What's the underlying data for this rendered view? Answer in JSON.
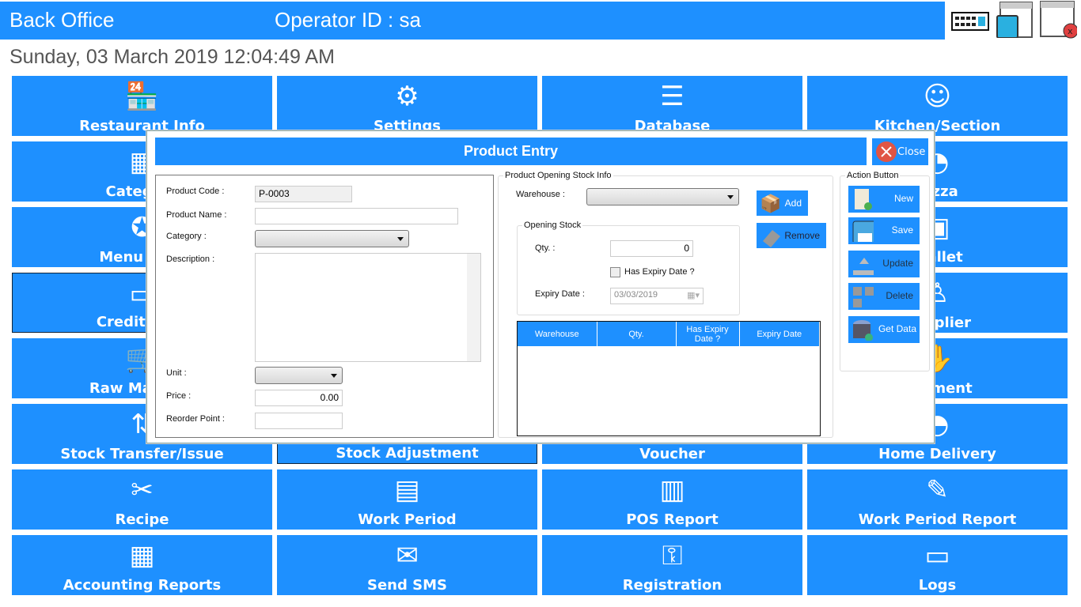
{
  "header": {
    "app_title": "Back Office",
    "operator": "Operator ID :  sa",
    "datetime": "Sunday, 03 March 2019 12:04:49 AM"
  },
  "tiles": [
    {
      "label": "Restaurant Info",
      "icon": "store-icon"
    },
    {
      "label": "Settings",
      "icon": "gear-icon"
    },
    {
      "label": "Database",
      "icon": "server-icon"
    },
    {
      "label": "Kitchen/Section",
      "icon": "chef-icon"
    },
    {
      "label": "Category",
      "icon": "grid-icon"
    },
    {
      "label": "",
      "icon": ""
    },
    {
      "label": "",
      "icon": ""
    },
    {
      "label": "Pizza",
      "icon": "pizza-icon"
    },
    {
      "label": "Menu Item",
      "icon": "badge-icon"
    },
    {
      "label": "",
      "icon": ""
    },
    {
      "label": "",
      "icon": ""
    },
    {
      "label": "Wallet",
      "icon": "wallet-icon"
    },
    {
      "label": "Credit Card",
      "icon": "credit-card-icon"
    },
    {
      "label": "",
      "icon": ""
    },
    {
      "label": "",
      "icon": ""
    },
    {
      "label": "Supplier",
      "icon": "supplier-icon"
    },
    {
      "label": "Raw Material",
      "icon": "cart-icon"
    },
    {
      "label": "",
      "icon": ""
    },
    {
      "label": "",
      "icon": ""
    },
    {
      "label": "Payment",
      "icon": "payment-icon"
    },
    {
      "label": "Stock Transfer/Issue",
      "icon": "transfer-icon"
    },
    {
      "label": "Stock Adjustment",
      "icon": ""
    },
    {
      "label": "Voucher",
      "icon": ""
    },
    {
      "label": "Home Delivery",
      "icon": "cloche-icon"
    },
    {
      "label": "Recipe",
      "icon": "recipe-icon"
    },
    {
      "label": "Work Period",
      "icon": "calendar-icon"
    },
    {
      "label": "POS Report",
      "icon": "cash-register-icon"
    },
    {
      "label": "Work Period Report",
      "icon": "report-icon"
    },
    {
      "label": "Accounting Reports",
      "icon": "calculator-icon"
    },
    {
      "label": "Send SMS",
      "icon": "envelope-icon"
    },
    {
      "label": "Registration",
      "icon": "key-icon"
    },
    {
      "label": "Logs",
      "icon": "laptop-icon"
    }
  ],
  "modal": {
    "title": "Product Entry",
    "close": "Close",
    "form": {
      "code_label": "Product Code :",
      "code": "P-0003",
      "name_label": "Product Name :",
      "name": "",
      "category_label": "Category :",
      "description_label": "Description :",
      "unit_label": "Unit :",
      "price_label": "Price :",
      "price": "0.00",
      "reorder_label": "Reorder Point :",
      "reorder": ""
    },
    "stock": {
      "group": "Product Opening Stock Info",
      "warehouse_label": "Warehouse :",
      "opening_group": "Opening Stock",
      "qty_label": "Qty. :",
      "qty": "0",
      "expiry_check": "Has Expiry Date ?",
      "expiry_label": "Expiry Date :",
      "expiry": "03/03/2019",
      "add": "Add",
      "remove": "Remove",
      "columns": [
        "Warehouse",
        "Qty.",
        "Has Expiry Date ?",
        "Expiry Date"
      ]
    },
    "actions": {
      "group": "Action Button",
      "new": "New",
      "save": "Save",
      "update": "Update",
      "delete": "Delete",
      "get_data": "Get Data"
    }
  }
}
